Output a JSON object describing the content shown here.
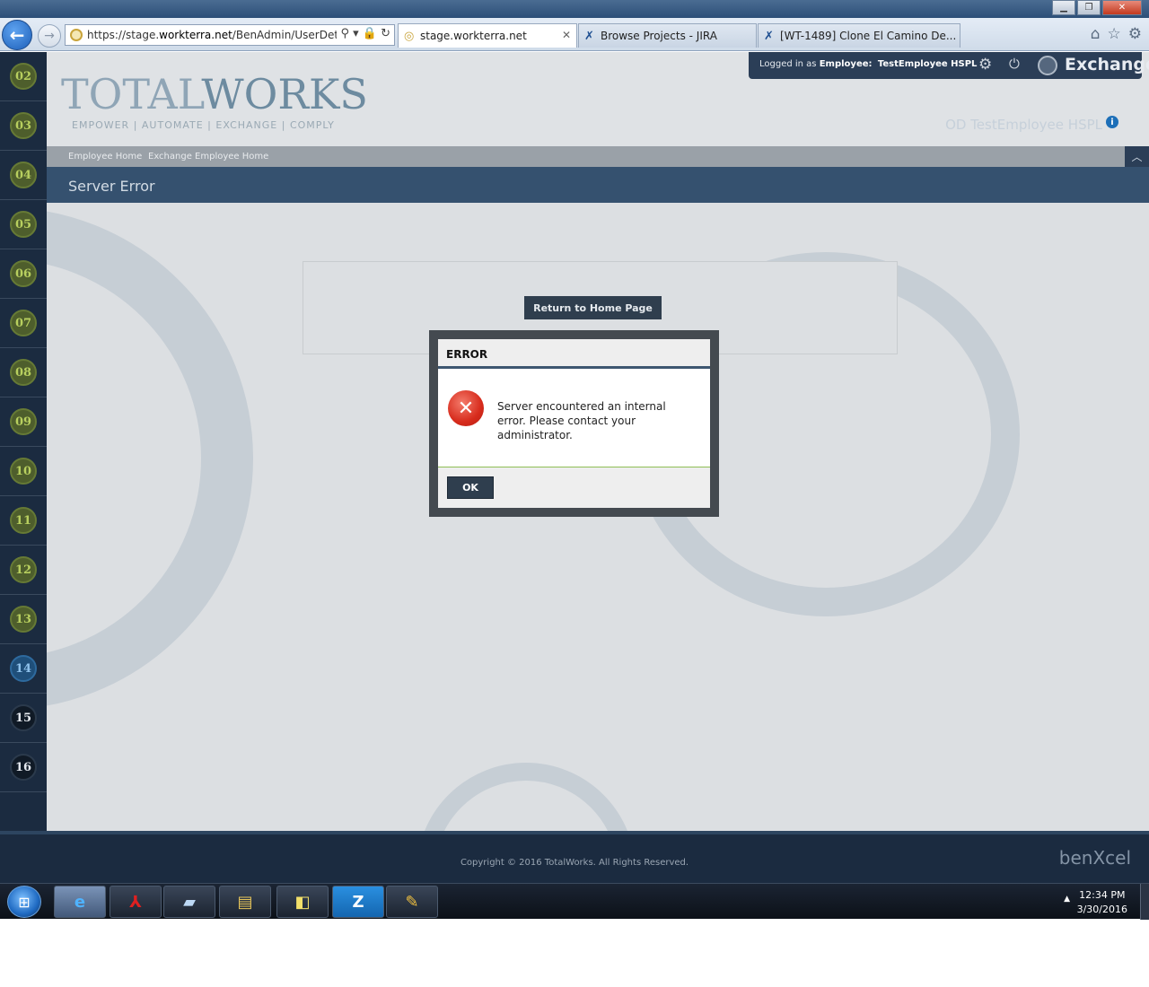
{
  "browser": {
    "address": "https://stage.workterra.net/BenAdmin/UserDetails/I",
    "address_prefix": "https://stage.",
    "address_domain": "workterra.net",
    "address_suffix": "/BenAdmin/UserDetails/I",
    "tabs": [
      {
        "label": "stage.workterra.net",
        "active": true
      },
      {
        "label": "Browse Projects - JIRA",
        "active": false
      },
      {
        "label": "[WT-1489] Clone El Camino De...",
        "active": false
      }
    ]
  },
  "sidebar": {
    "items": [
      {
        "label": "02",
        "style": "green"
      },
      {
        "label": "03",
        "style": "green"
      },
      {
        "label": "04",
        "style": "green"
      },
      {
        "label": "05",
        "style": "green"
      },
      {
        "label": "06",
        "style": "green"
      },
      {
        "label": "07",
        "style": "green"
      },
      {
        "label": "08",
        "style": "green"
      },
      {
        "label": "09",
        "style": "green"
      },
      {
        "label": "10",
        "style": "green"
      },
      {
        "label": "11",
        "style": "green"
      },
      {
        "label": "12",
        "style": "green"
      },
      {
        "label": "13",
        "style": "green"
      },
      {
        "label": "14",
        "style": "blue"
      },
      {
        "label": "15",
        "style": "dark"
      },
      {
        "label": "16",
        "style": "dark"
      }
    ]
  },
  "header": {
    "logo_part1": "TOTAL",
    "logo_part2": "WORKS",
    "tagline": "EMPOWER | AUTOMATE | EXCHANGE | COMPLY",
    "login_prefix": "Logged in as",
    "login_role": "Employee:",
    "login_user": "TestEmployee HSPL",
    "exchange_label": "Exchange",
    "user_watermark": "OD TestEmployee HSPL"
  },
  "breadcrumb": {
    "items": [
      "Employee Home",
      "Exchange Employee Home"
    ]
  },
  "page": {
    "title": "Server Error",
    "home_button": "Return to Home Page"
  },
  "dialog": {
    "title": "ERROR",
    "message": "Server encountered an internal error. Please contact your administrator.",
    "ok_label": "OK"
  },
  "footer": {
    "copyright": "Copyright © 2016 TotalWorks. All Rights Reserved.",
    "brand": "benXcel"
  },
  "taskbar": {
    "time": "12:34 PM",
    "date": "3/30/2016",
    "apps": [
      "internet-explorer",
      "adobe-reader",
      "notepad",
      "file-explorer",
      "sticky-notes",
      "zoom",
      "paint"
    ]
  },
  "colors": {
    "sidebar_bg": "#1b2b40",
    "title_bar": "#35516f",
    "modal_button": "#2f3e4e",
    "error_red": "#d72b1c"
  }
}
